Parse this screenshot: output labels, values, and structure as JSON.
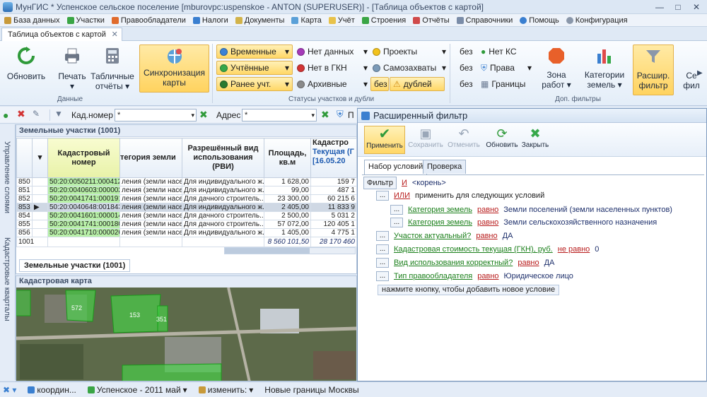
{
  "window": {
    "title": "МунГИС * Успенское сельское поселение   [mburovpc:uspenskoe - ANTON (SUPERUSER)] - [Таблица объектов с картой]"
  },
  "menu": [
    "База данных",
    "Участки",
    "Правообладатели",
    "Налоги",
    "Документы",
    "Карта",
    "Учёт",
    "Строения",
    "Отчёты",
    "Справочники",
    "Помощь",
    "Конфигурация"
  ],
  "doctab": {
    "label": "Таблица объектов с картой"
  },
  "ribbon": {
    "refresh": "Обновить",
    "data_group": "Данные",
    "print": "Печать",
    "tab_reports": [
      "Табличные",
      "отчёты"
    ],
    "sync": [
      "Синхронизация",
      "карты"
    ],
    "status_btns": [
      "Временные",
      "Учтённые",
      "Ранее учт.",
      "Архивные"
    ],
    "nodata": "Нет данных",
    "nogkn": "Нет в ГКН",
    "projects": "Проекты",
    "seizures": "Самозахваты",
    "without": "без",
    "dups": "дублей",
    "status_group": "Статусы участков и дубли",
    "bez_labels": [
      "без",
      "без",
      "без"
    ],
    "no_ks": "Нет КС",
    "rights": "Права",
    "borders": "Границы",
    "zone": [
      "Зона",
      "работ"
    ],
    "categories": [
      "Категории",
      "земель"
    ],
    "ext_filter": [
      "Расшир.",
      "фильтр"
    ],
    "more": [
      "Се",
      "фил"
    ],
    "extra_group": "Доп. фильтры"
  },
  "filterbar": {
    "cad_label": "Кад.номер",
    "cad_value": "*",
    "addr_label": "Адрес",
    "addr_value": "*",
    "cut": "П"
  },
  "side_tabs": [
    "Управление слоями",
    "Кадастровые кварталы"
  ],
  "grid": {
    "title": "Земельные участки (1001)",
    "headers": [
      "Кадастровый номер",
      "тегория земли",
      "Разрешённый вид использования (РВИ)",
      "Площадь, кв.м",
      "Кадастро"
    ],
    "sub_header": [
      "Текущая (Г",
      "[16.05.20"
    ],
    "rows": [
      {
        "n": "850",
        "cad": "50:20:0050211:000412",
        "cat": "ления (земли насе...",
        "rvi": "Для индивидуального ж...",
        "area": "1 628,00",
        "cost": "159 7"
      },
      {
        "n": "851",
        "cad": "50:20:0040603:000002",
        "cat": "ления (земли насе...",
        "rvi": "Для индивидуального ж...",
        "area": "99,00",
        "cost": "487 1"
      },
      {
        "n": "852",
        "cad": "50:20:0041741:000191",
        "cat": "ления (земли насе...",
        "rvi": "Для дачного строитель...",
        "area": "23 300,00",
        "cost": "60 215 6"
      },
      {
        "n": "853",
        "cad": "50:20:0040648:001843",
        "cat": "ления (земли насе...",
        "rvi": "Для индивидуального ж...",
        "area": "2 405,00",
        "cost": "11 833 9"
      },
      {
        "n": "854",
        "cad": "50:20:0041601:000014",
        "cat": "ления (земли насе...",
        "rvi": "Для дачного строитель...",
        "area": "2 500,00",
        "cost": "5 031 2"
      },
      {
        "n": "855",
        "cad": "50:20:0041741:000180",
        "cat": "ления (земли насе...",
        "rvi": "Для дачного строитель...",
        "area": "57 072,00",
        "cost": "120 405 1"
      },
      {
        "n": "856",
        "cad": "50:20:0041710:000026",
        "cat": "ления (земли насе...",
        "rvi": "Для индивидуального ж...",
        "area": "1 405,00",
        "cost": "4 775 1"
      }
    ],
    "footer": {
      "count": "1001",
      "area": "8 560 101,50",
      "cost": "28 170 460"
    },
    "bottom_tab": "Земельные участки (1001)"
  },
  "map": {
    "title": "Кадастровая карта",
    "labels": [
      "572",
      "153",
      "351"
    ]
  },
  "dialog": {
    "title": "Расширенный фильтр",
    "toolbar": [
      "Применить",
      "Сохранить",
      "Отменить",
      "Обновить",
      "Закрыть"
    ],
    "tabs": [
      "Набор условий",
      "Проверка"
    ],
    "root": {
      "filter": "Фильтр",
      "and": "И",
      "root": "<корень>"
    },
    "or_row": {
      "op": "ИЛИ",
      "text": "применить для следующих условий"
    },
    "conds": [
      {
        "field": "Категория земель",
        "op": "равно",
        "value": "Земли поселений (земли населенных пунктов)"
      },
      {
        "field": "Категория земель",
        "op": "равно",
        "value": "Земли сельскохозяйственного назначения"
      },
      {
        "field": "Участок актуальный?",
        "op": "равно",
        "value": "ДА"
      },
      {
        "field": "Кадастровая стоимость текущая (ГКН), руб.",
        "op": "не равно",
        "value": "0"
      },
      {
        "field": "Вид использования корректный?",
        "op": "равно",
        "value": "ДА"
      },
      {
        "field": "Тип правообладателя",
        "op": "равно",
        "value": "Юридическое лицо"
      }
    ],
    "add_hint": "нажмите кнопку, чтобы добавить новое условие"
  },
  "status": {
    "items": [
      "координ...",
      "Успенское - 2011 май",
      "изменить:",
      "Новые границы Москвы"
    ]
  },
  "colors": {
    "accent": "#ffd35f",
    "cad_cell": "#b8f0a8",
    "field": "#1a7f1a",
    "op": "#b81c1c",
    "value": "#1d2f6b"
  }
}
